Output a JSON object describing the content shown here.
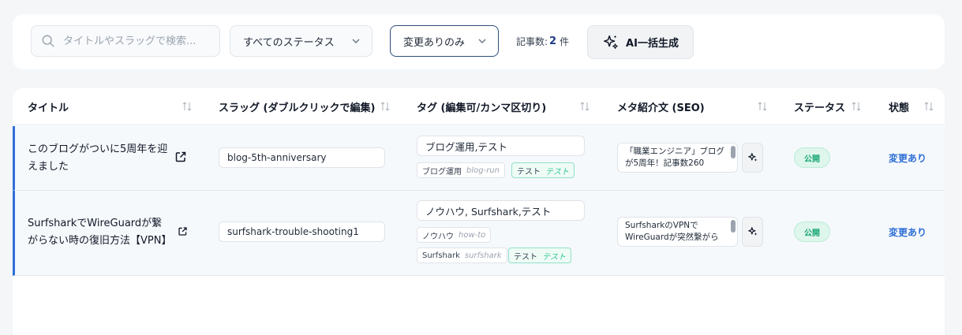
{
  "toolbar": {
    "search_placeholder": "タイトルやスラッグで検索...",
    "status_filter": "すべてのステータス",
    "changed_filter": "変更ありのみ",
    "count_label": "記事数:",
    "count_value": "2",
    "count_unit": "件",
    "ai_button": "AI一括生成"
  },
  "table": {
    "headers": [
      "タイトル",
      "スラッグ (ダブルクリックで編集)",
      "タグ (編集可/カンマ区切り)",
      "メタ紹介文 (SEO)",
      "ステータス",
      "状態"
    ],
    "rows": [
      {
        "title": "このブログがついに5周年を迎えました",
        "slug": "blog-5th-anniversary",
        "tags_input": "ブログ運用,テスト",
        "tags": [
          {
            "name": "ブログ運用",
            "slug": "blog-run"
          },
          {
            "name": "テスト",
            "slug": "テスト"
          }
        ],
        "meta": "「職業エンジニア」ブログが5周年！記事数260",
        "status": "公開",
        "state": "変更あり"
      },
      {
        "title": "SurfsharkでWireGuardが繋がらない時の復旧方法【VPN】",
        "slug": "surfshark-trouble-shooting1",
        "tags_input": "ノウハウ, Surfshark,テスト",
        "tags": [
          {
            "name": "ノウハウ",
            "slug": "how-to"
          },
          {
            "name": "Surfshark",
            "slug": "surfshark"
          },
          {
            "name": "テスト",
            "slug": "テスト"
          }
        ],
        "meta": "SurfsharkのVPNでWireGuardが突然繋がら",
        "status": "公開",
        "state": "変更あり"
      }
    ]
  },
  "colors": {
    "accent": "#2f6fd6",
    "success": "#17a673",
    "tag_green": "#34c79a"
  }
}
